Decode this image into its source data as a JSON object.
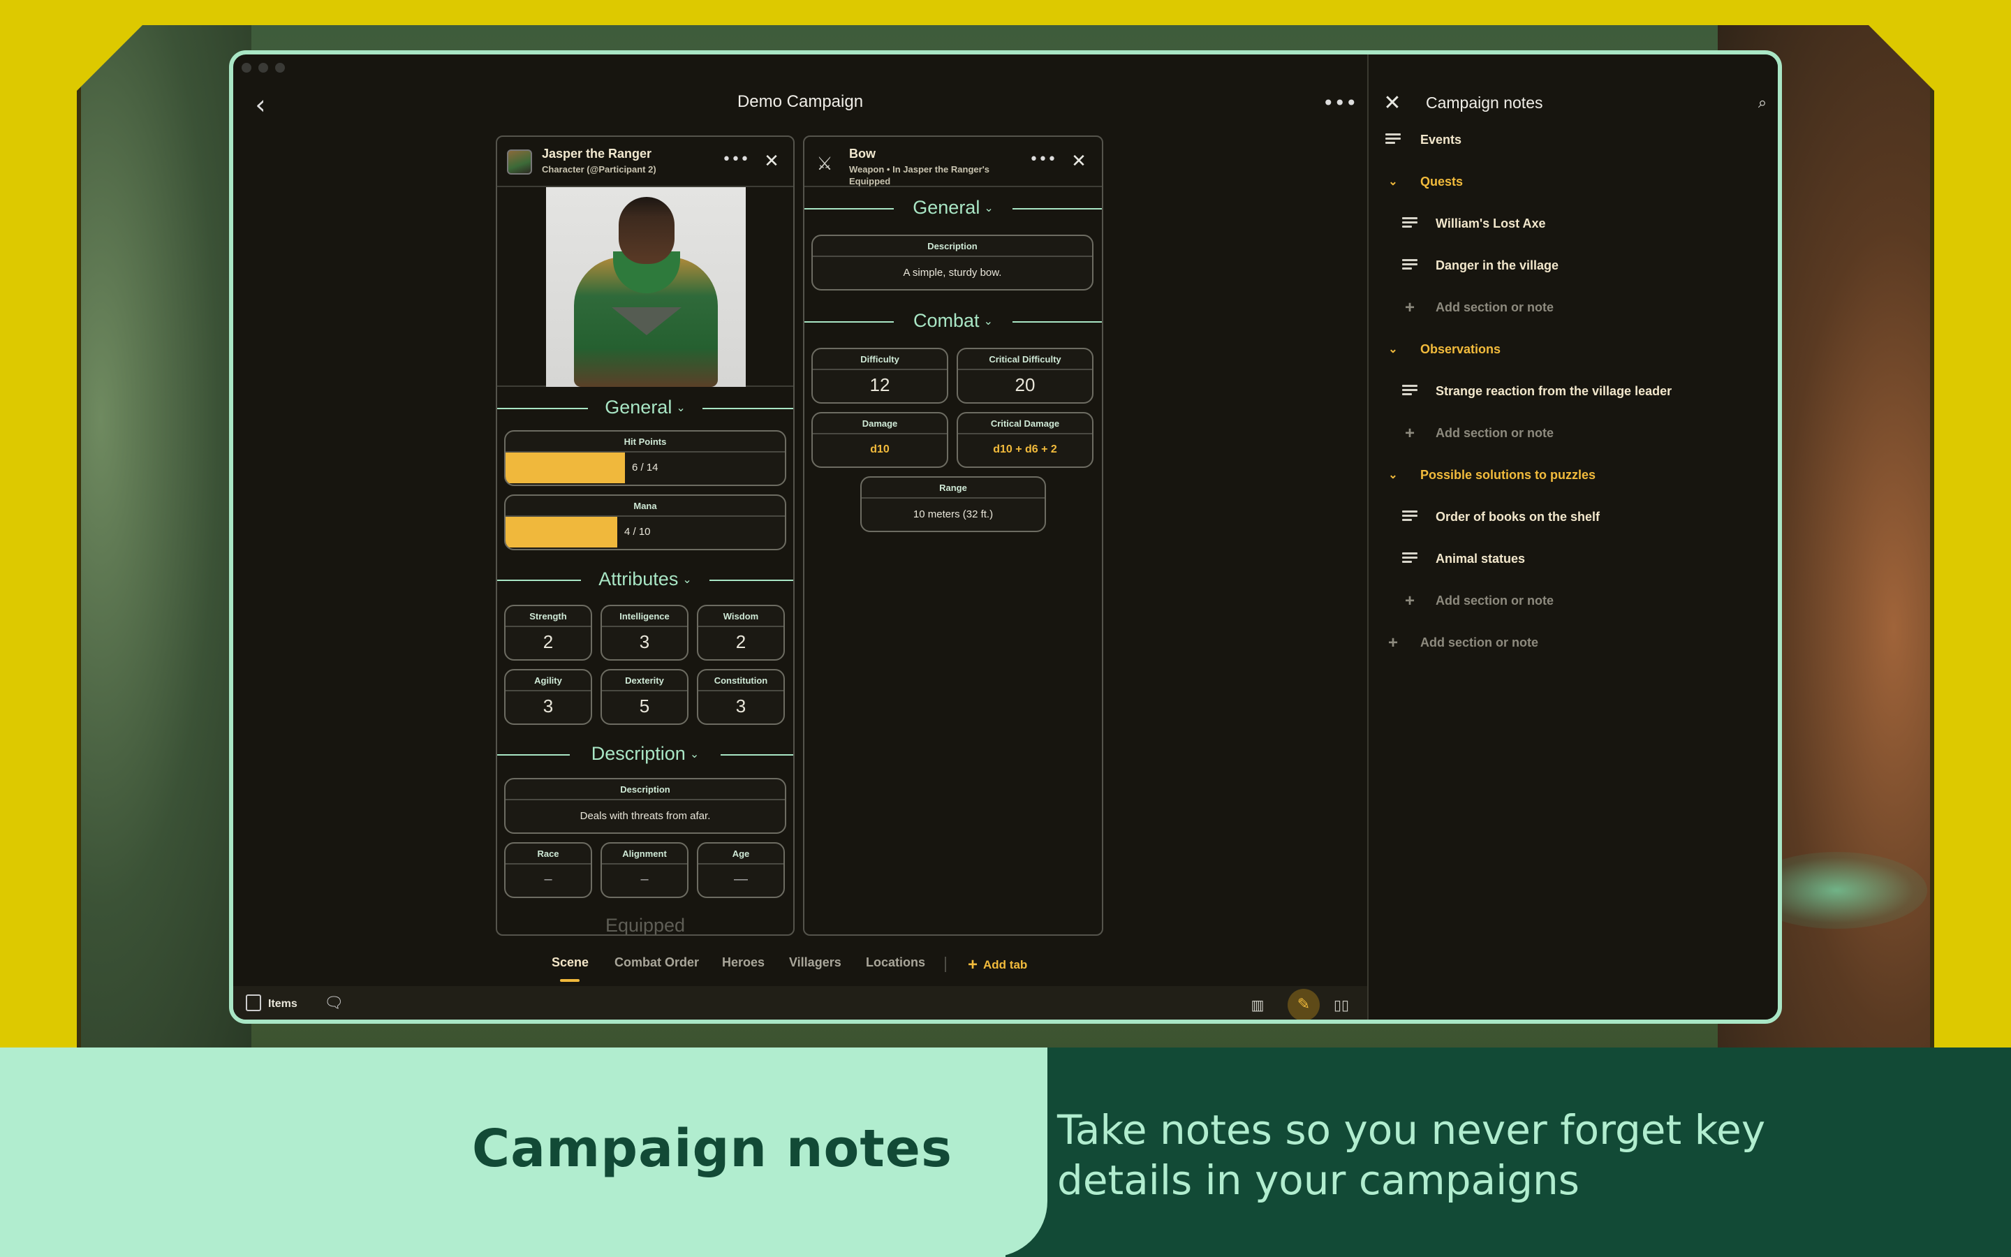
{
  "window": {
    "title": "Demo Campaign"
  },
  "character_card": {
    "name": "Jasper the Ranger",
    "subtitle": "Character (@Participant 2)",
    "general_section": "General",
    "hit_points": {
      "label": "Hit Points",
      "text": "6 / 14",
      "current": 6,
      "max": 14
    },
    "mana": {
      "label": "Mana",
      "text": "4 / 10",
      "current": 4,
      "max": 10
    },
    "attributes_section": "Attributes",
    "attributes": [
      {
        "label": "Strength",
        "value": "2"
      },
      {
        "label": "Intelligence",
        "value": "3"
      },
      {
        "label": "Wisdom",
        "value": "2"
      },
      {
        "label": "Agility",
        "value": "3"
      },
      {
        "label": "Dexterity",
        "value": "5"
      },
      {
        "label": "Constitution",
        "value": "3"
      }
    ],
    "description_section": "Description",
    "description": {
      "label": "Description",
      "value": "Deals with threats from afar."
    },
    "race": {
      "label": "Race",
      "value": "–"
    },
    "alignment": {
      "label": "Alignment",
      "value": "–"
    },
    "age": {
      "label": "Age",
      "value": "—"
    },
    "equipped_section": "Equipped"
  },
  "weapon_card": {
    "name": "Bow",
    "subtitle": "Weapon • In Jasper the Ranger's Equipped",
    "general_section": "General",
    "description": {
      "label": "Description",
      "value": "A simple, sturdy bow."
    },
    "combat_section": "Combat",
    "difficulty": {
      "label": "Difficulty",
      "value": "12"
    },
    "critical_difficulty": {
      "label": "Critical Difficulty",
      "value": "20"
    },
    "damage": {
      "label": "Damage",
      "value": "d10"
    },
    "critical_damage": {
      "label": "Critical Damage",
      "value": "d10 + d6 + 2"
    },
    "range": {
      "label": "Range",
      "value": "10 meters (32 ft.)"
    }
  },
  "tabs": [
    {
      "label": "Scene",
      "active": true
    },
    {
      "label": "Combat Order",
      "active": false
    },
    {
      "label": "Heroes",
      "active": false
    },
    {
      "label": "Villagers",
      "active": false
    },
    {
      "label": "Locations",
      "active": false
    }
  ],
  "add_tab_label": "Add tab",
  "bottom_bar": {
    "items_label": "Items"
  },
  "notes": {
    "title": "Campaign notes",
    "rows": [
      {
        "type": "note",
        "label": "Events"
      },
      {
        "type": "section",
        "label": "Quests"
      },
      {
        "type": "note",
        "label": "William's Lost Axe"
      },
      {
        "type": "note",
        "label": "Danger in the village"
      },
      {
        "type": "add",
        "label": "Add section or note"
      },
      {
        "type": "section",
        "label": "Observations"
      },
      {
        "type": "note",
        "label": "Strange reaction from the village leader"
      },
      {
        "type": "add",
        "label": "Add section or note"
      },
      {
        "type": "section",
        "label": "Possible solutions to puzzles"
      },
      {
        "type": "note",
        "label": "Order of books on the shelf"
      },
      {
        "type": "note",
        "label": "Animal statues"
      },
      {
        "type": "add",
        "label": "Add section or note"
      },
      {
        "type": "add",
        "label": "Add section or note"
      }
    ]
  },
  "caption": {
    "heading": "Campaign notes",
    "text": "Take notes so you never forget key details in your campaigns"
  },
  "colors": {
    "accent_gold": "#f2bb3c",
    "accent_mint": "#a9e6c5",
    "band_dark": "#124a36",
    "frame_yellow": "#ddc900"
  }
}
